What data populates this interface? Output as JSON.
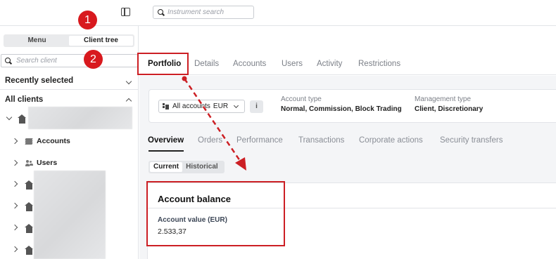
{
  "topbar": {
    "search_placeholder": "Instrument search"
  },
  "sidebar": {
    "segments": [
      "Menu",
      "Client tree"
    ],
    "active_segment": "Client tree",
    "search_placeholder": "Search client",
    "recently_selected": "Recently selected",
    "all_clients": "All clients",
    "tree_items": [
      {
        "label": "Accounts",
        "icon": "stack-icon"
      },
      {
        "label": "Users",
        "icon": "users-icon"
      }
    ]
  },
  "main": {
    "tabs": [
      "Portfolio",
      "Details",
      "Accounts",
      "Users",
      "Activity",
      "Restrictions"
    ],
    "active_tab": "Portfolio",
    "account_selector": {
      "label": "All accounts",
      "currency": "EUR"
    },
    "info_label": "i",
    "account_type": {
      "label": "Account type",
      "value": "Normal, Commission, Block Trading"
    },
    "management_type": {
      "label": "Management type",
      "value": "Client, Discretionary"
    },
    "subtabs": [
      "Overview",
      "Orders",
      "Performance",
      "Transactions",
      "Corporate actions",
      "Security transfers"
    ],
    "active_subtab": "Overview",
    "view_toggle": [
      "Current",
      "Historical"
    ],
    "active_view": "Current",
    "balance": {
      "title": "Account balance",
      "value_label": "Account value (EUR)",
      "value": "2.533,37"
    }
  },
  "annotations": {
    "badges": [
      "1",
      "2"
    ],
    "highlight_color": "#cc1f24"
  }
}
